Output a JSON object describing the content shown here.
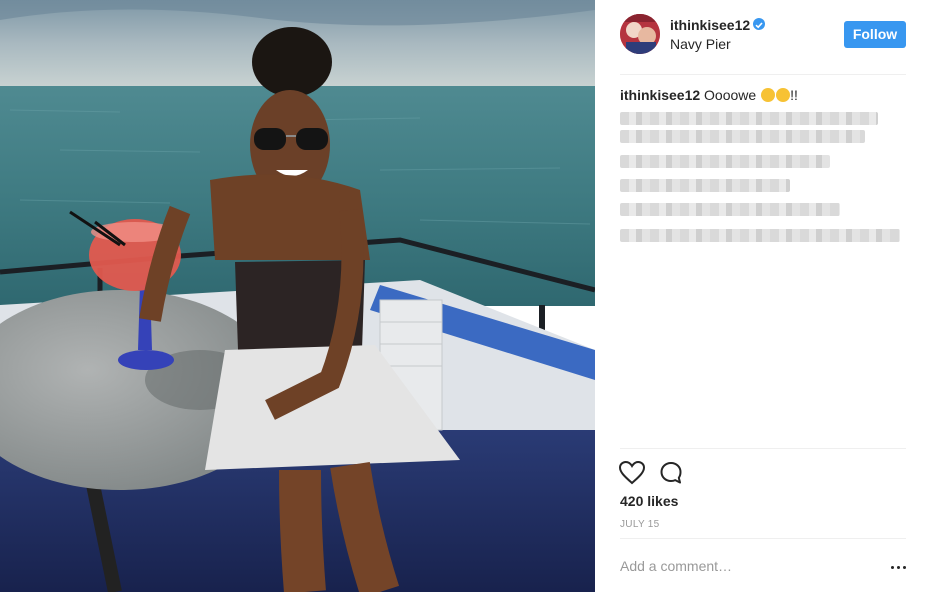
{
  "post": {
    "username": "ithinkisee12",
    "location": "Navy Pier",
    "follow_label": "Follow",
    "caption_username": "ithinkisee12",
    "caption_text": "Oooowe",
    "caption_suffix": "!!",
    "likes": "420 likes",
    "date": "JULY 15",
    "comment_placeholder": "Add a comment…"
  },
  "icons": {
    "verified": "verified-badge-icon",
    "like": "heart-icon",
    "comment": "speech-bubble-icon",
    "more": "more-options-icon"
  },
  "colors": {
    "accent": "#3897f0",
    "text": "#262626",
    "muted": "#999999",
    "divider": "#efefef"
  }
}
